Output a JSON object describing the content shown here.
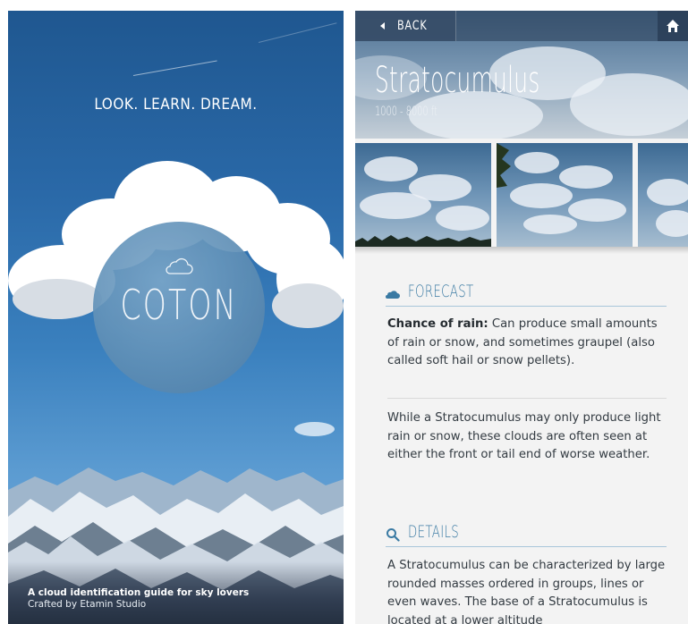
{
  "splash": {
    "tagline": "LOOK. LEARN. DREAM.",
    "logo_text": "COTON",
    "footer_title": "A cloud identification guide for sky lovers",
    "footer_subtitle": "Crafted by Etamin Studio"
  },
  "detail": {
    "back_label": "BACK",
    "cloud_name": "Stratocumulus",
    "altitude": "1000 - 8000 ft",
    "forecast": {
      "title": "FORECAST",
      "rain_label": "Chance of rain:",
      "rain_text": " Can produce small amounts of rain or snow, and sometimes graupel (also called soft hail or snow pellets).",
      "body": "While a Stratocumulus may only produce light rain or snow, these clouds are often seen at either the front or tail end of worse weather."
    },
    "details": {
      "title": "DETAILS",
      "body": "A Stratocumulus can be characterized by large rounded masses ordered in groups, lines or even waves. The base of a Stratocumulus is located at a lower altitude"
    }
  },
  "colors": {
    "accent": "#3a7aa3",
    "body_text": "#333b42",
    "divider": "#a8c6da"
  },
  "icons": [
    "cloud-icon",
    "back-arrow-icon",
    "home-icon",
    "search-icon"
  ]
}
